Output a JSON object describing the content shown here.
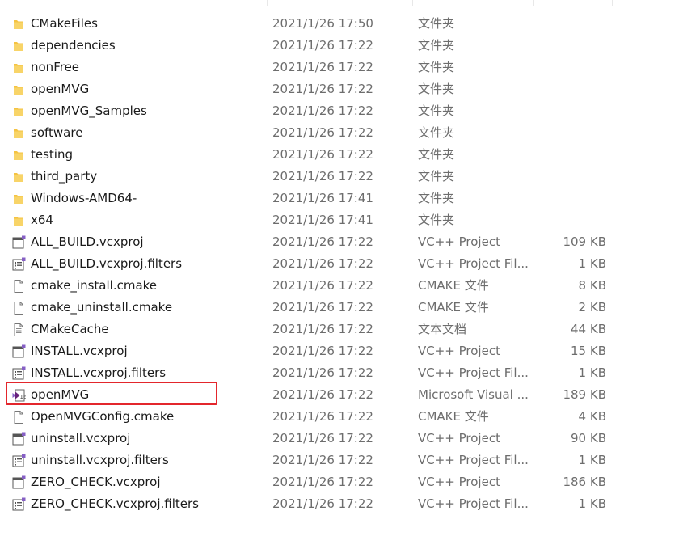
{
  "files": [
    {
      "name": "CMakeFiles",
      "date": "2021/1/26 17:50",
      "type": "文件夹",
      "size": "",
      "icon": "folder-icon"
    },
    {
      "name": "dependencies",
      "date": "2021/1/26 17:22",
      "type": "文件夹",
      "size": "",
      "icon": "folder-icon"
    },
    {
      "name": "nonFree",
      "date": "2021/1/26 17:22",
      "type": "文件夹",
      "size": "",
      "icon": "folder-icon"
    },
    {
      "name": "openMVG",
      "date": "2021/1/26 17:22",
      "type": "文件夹",
      "size": "",
      "icon": "folder-icon"
    },
    {
      "name": "openMVG_Samples",
      "date": "2021/1/26 17:22",
      "type": "文件夹",
      "size": "",
      "icon": "folder-icon"
    },
    {
      "name": "software",
      "date": "2021/1/26 17:22",
      "type": "文件夹",
      "size": "",
      "icon": "folder-icon"
    },
    {
      "name": "testing",
      "date": "2021/1/26 17:22",
      "type": "文件夹",
      "size": "",
      "icon": "folder-icon"
    },
    {
      "name": "third_party",
      "date": "2021/1/26 17:22",
      "type": "文件夹",
      "size": "",
      "icon": "folder-icon"
    },
    {
      "name": "Windows-AMD64-",
      "date": "2021/1/26 17:41",
      "type": "文件夹",
      "size": "",
      "icon": "folder-icon"
    },
    {
      "name": "x64",
      "date": "2021/1/26 17:41",
      "type": "文件夹",
      "size": "",
      "icon": "folder-icon"
    },
    {
      "name": "ALL_BUILD.vcxproj",
      "date": "2021/1/26 17:22",
      "type": "VC++ Project",
      "size": "109 KB",
      "icon": "vcxproj-icon"
    },
    {
      "name": "ALL_BUILD.vcxproj.filters",
      "date": "2021/1/26 17:22",
      "type": "VC++ Project Fil...",
      "size": "1 KB",
      "icon": "vcxproj-filters-icon"
    },
    {
      "name": "cmake_install.cmake",
      "date": "2021/1/26 17:22",
      "type": "CMAKE 文件",
      "size": "8 KB",
      "icon": "blank-file-icon"
    },
    {
      "name": "cmake_uninstall.cmake",
      "date": "2021/1/26 17:22",
      "type": "CMAKE 文件",
      "size": "2 KB",
      "icon": "blank-file-icon"
    },
    {
      "name": "CMakeCache",
      "date": "2021/1/26 17:22",
      "type": "文本文档",
      "size": "44 KB",
      "icon": "text-file-icon"
    },
    {
      "name": "INSTALL.vcxproj",
      "date": "2021/1/26 17:22",
      "type": "VC++ Project",
      "size": "15 KB",
      "icon": "vcxproj-icon"
    },
    {
      "name": "INSTALL.vcxproj.filters",
      "date": "2021/1/26 17:22",
      "type": "VC++ Project Fil...",
      "size": "1 KB",
      "icon": "vcxproj-filters-icon"
    },
    {
      "name": "openMVG",
      "date": "2021/1/26 17:22",
      "type": "Microsoft Visual ...",
      "size": "189 KB",
      "icon": "visual-studio-solution-icon"
    },
    {
      "name": "OpenMVGConfig.cmake",
      "date": "2021/1/26 17:22",
      "type": "CMAKE 文件",
      "size": "4 KB",
      "icon": "blank-file-icon"
    },
    {
      "name": "uninstall.vcxproj",
      "date": "2021/1/26 17:22",
      "type": "VC++ Project",
      "size": "90 KB",
      "icon": "vcxproj-icon"
    },
    {
      "name": "uninstall.vcxproj.filters",
      "date": "2021/1/26 17:22",
      "type": "VC++ Project Fil...",
      "size": "1 KB",
      "icon": "vcxproj-filters-icon"
    },
    {
      "name": "ZERO_CHECK.vcxproj",
      "date": "2021/1/26 17:22",
      "type": "VC++ Project",
      "size": "186 KB",
      "icon": "vcxproj-icon"
    },
    {
      "name": "ZERO_CHECK.vcxproj.filters",
      "date": "2021/1/26 17:22",
      "type": "VC++ Project Fil...",
      "size": "1 KB",
      "icon": "vcxproj-filters-icon"
    }
  ],
  "colors": {
    "folder": "#f5c342",
    "highlight": "#e3262c",
    "vs_purple": "#865fc5"
  }
}
